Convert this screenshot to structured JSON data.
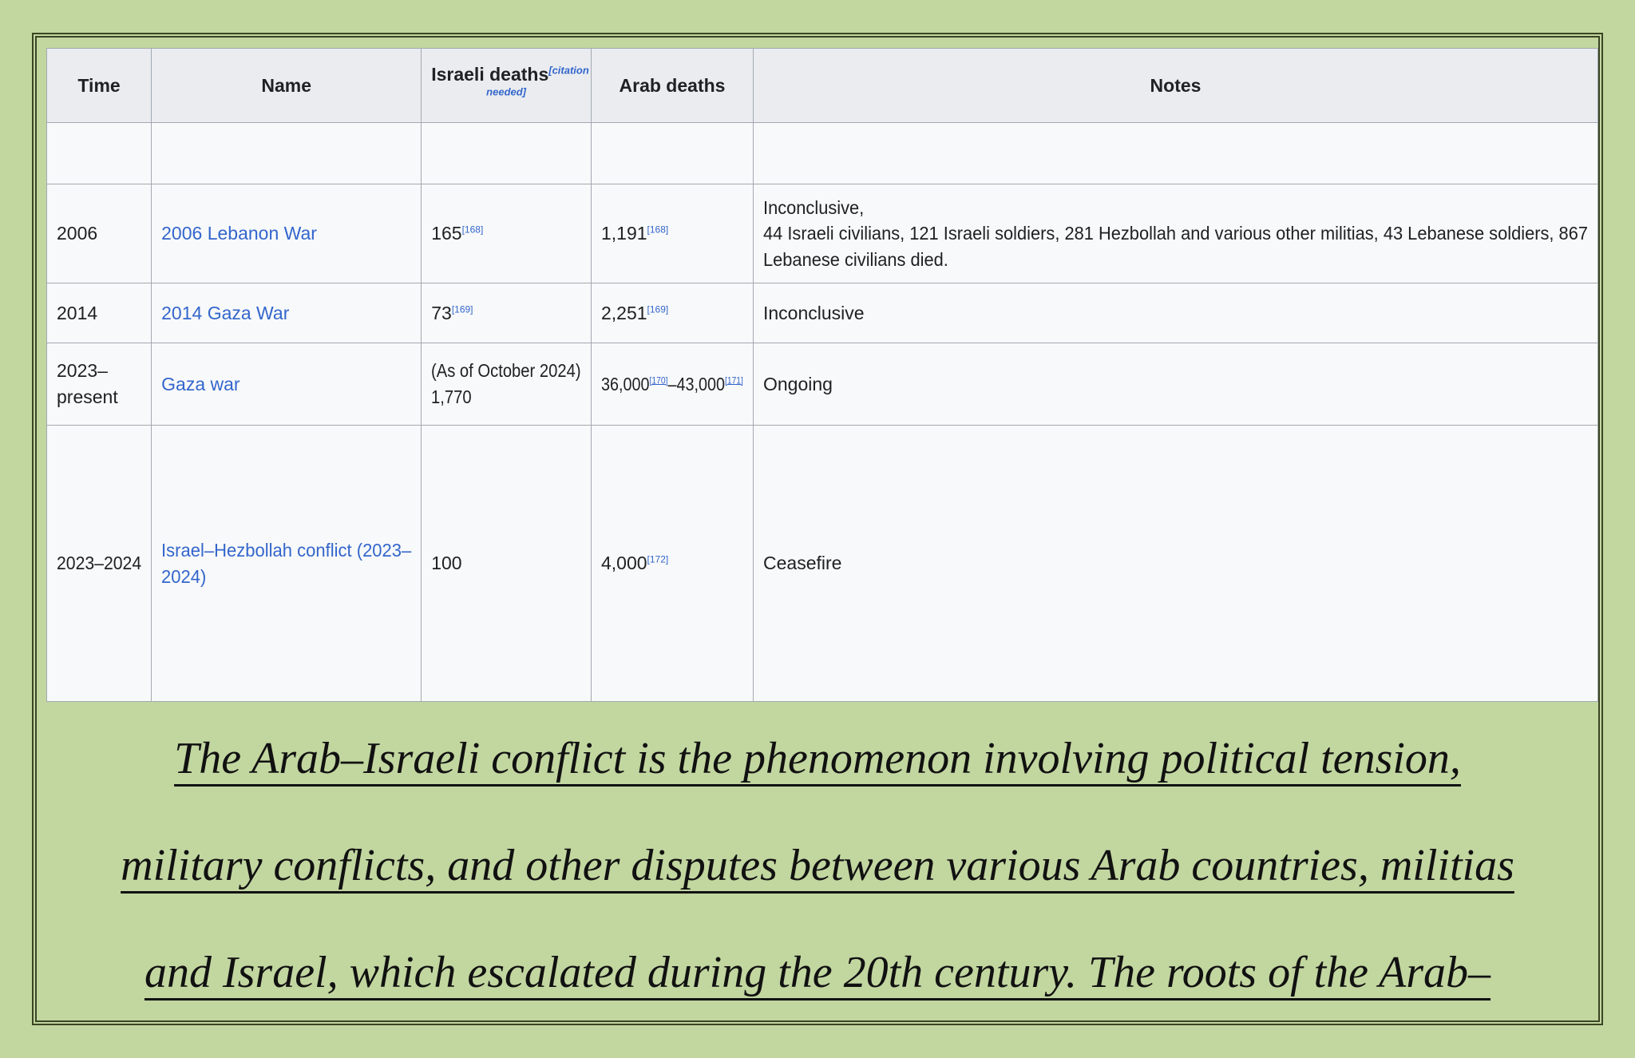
{
  "colors": {
    "page_bg": "#c2d6a0",
    "frame_border": "#3a4522",
    "header_bg": "#eaecf0",
    "row_bg": "#f8f9fa",
    "grid": "#a2a9b1",
    "text": "#202122",
    "link": "#3366cc"
  },
  "table": {
    "columns": [
      {
        "label": "Time"
      },
      {
        "label": "Name"
      },
      {
        "label": "Israeli deaths",
        "citation_line1": "[citation",
        "citation_line2": "needed]"
      },
      {
        "label": "Arab deaths"
      },
      {
        "label": "Notes"
      }
    ],
    "rows": [
      {
        "time": [],
        "name": [],
        "israeli": [],
        "arab": [],
        "notes": []
      },
      {
        "time": [
          {
            "t": "2006"
          }
        ],
        "name": [
          {
            "link": "2006 Lebanon War"
          }
        ],
        "israeli": [
          {
            "t": "165"
          },
          {
            "sup": "[168]"
          }
        ],
        "arab": [
          {
            "t": "1,191"
          },
          {
            "sup": "[168]"
          }
        ],
        "notes": [
          {
            "t": "Inconclusive,"
          },
          {
            "br": true
          },
          {
            "t": "44 Israeli civilians, 121 Israeli soldiers, 281 Hezbollah and various other militias, 43 Lebanese soldiers, 867"
          },
          {
            "br": true
          },
          {
            "t": "Lebanese civilians died."
          }
        ]
      },
      {
        "time": [
          {
            "t": "2014"
          }
        ],
        "name": [
          {
            "link": "2014 Gaza War"
          }
        ],
        "israeli": [
          {
            "t": "73"
          },
          {
            "sup": "[169]"
          }
        ],
        "arab": [
          {
            "t": "2,251"
          },
          {
            "sup": "[169]"
          }
        ],
        "notes": [
          {
            "t": "Inconclusive"
          }
        ]
      },
      {
        "time": [
          {
            "t": "2023–"
          },
          {
            "br": true
          },
          {
            "t": "present"
          }
        ],
        "name": [
          {
            "link": "Gaza war"
          }
        ],
        "israeli": [
          {
            "t": "(As of October 2024)"
          },
          {
            "br": true
          },
          {
            "t": "1,770"
          }
        ],
        "arab": [
          {
            "t": "36,000"
          },
          {
            "sup": "[170]",
            "u": true
          },
          {
            "t": "–43,000"
          },
          {
            "sup": "[171]",
            "u": true
          }
        ],
        "notes": [
          {
            "t": "Ongoing"
          }
        ]
      },
      {
        "time": [
          {
            "t": "2023–2024"
          }
        ],
        "name": [
          {
            "link": [
              "Israel–Hezbollah conflict (2023–",
              "2024)"
            ]
          }
        ],
        "israeli": [
          {
            "t": "100"
          }
        ],
        "arab": [
          {
            "t": "4,000"
          },
          {
            "sup": "[172]"
          }
        ],
        "notes": [
          {
            "t": "Ceasefire"
          }
        ]
      }
    ]
  },
  "caption": {
    "lines": [
      "The Arab–Israeli conflict is the phenomenon involving political tension,",
      "military conflicts, and other disputes between various Arab countries, militias",
      "and Israel, which escalated during the 20th century. The roots of the Arab–"
    ]
  }
}
